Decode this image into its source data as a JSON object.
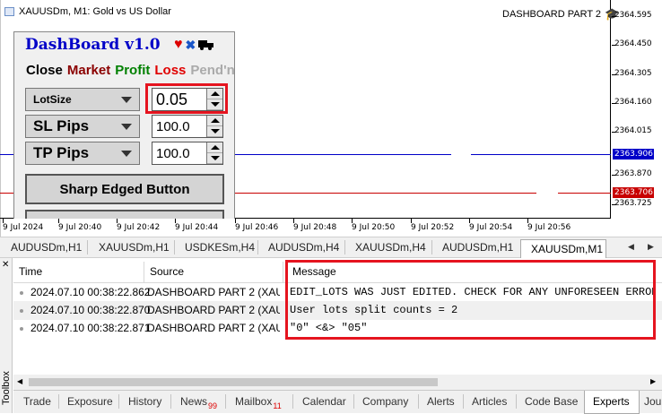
{
  "chart": {
    "title": "XAUUSDm, M1:  Gold vs US Dollar",
    "ea_name": "DASHBOARD PART 2",
    "price_labels": [
      "2364.595",
      "2364.450",
      "2364.305",
      "2364.160",
      "2364.015",
      "2363.870",
      "2363.725"
    ],
    "bid_label": "2363.906",
    "ask_label": "2363.706",
    "bid_color": "#0000c8",
    "ask_color": "#c80000",
    "time_labels": [
      "9 Jul 2024",
      "9 Jul 20:40",
      "9 Jul 20:42",
      "9 Jul 20:44",
      "9 Jul 20:46",
      "9 Jul 20:48",
      "9 Jul 20:50",
      "9 Jul 20:52",
      "9 Jul 20:54",
      "9 Jul 20:56"
    ]
  },
  "dashboard": {
    "title": "DashBoard v1.0",
    "tabs": {
      "close": "Close",
      "market": "Market",
      "profit": "Profit",
      "loss": "Loss",
      "pending": "Pend'n"
    },
    "lotsize": {
      "label": "LotSize",
      "value": "0.05"
    },
    "sl": {
      "label": "SL Pips",
      "value": "100.0"
    },
    "tp": {
      "label": "TP Pips",
      "value": "100.0"
    },
    "button_label": "Sharp Edged Button",
    "highlight_color": "#e5141f"
  },
  "symbol_tabs": [
    "AUDUSDm,H1",
    "XAUUSDm,H1",
    "USDKESm,H4",
    "AUDUSDm,H4",
    "XAUUSDm,H4",
    "AUDUSDm,H1",
    "XAUUSDm,M1"
  ],
  "toolbox": {
    "label": "Toolbox",
    "columns": {
      "time": "Time",
      "source": "Source",
      "message": "Message"
    },
    "rows": [
      {
        "time": "2024.07.10 00:38:22.862",
        "source": "DASHBOARD PART 2 (XAU...",
        "message": "EDIT_LOTS WAS JUST EDITED. CHECK FOR ANY UNFORESEEN ERRORS."
      },
      {
        "time": "2024.07.10 00:38:22.870",
        "source": "DASHBOARD PART 2 (XAU...",
        "message": "User lots split counts = 2"
      },
      {
        "time": "2024.07.10 00:38:22.871",
        "source": "DASHBOARD PART 2 (XAU...",
        "message": "\"0\" <&> \"05\""
      }
    ]
  },
  "bottom_tabs": [
    {
      "label": "Trade"
    },
    {
      "label": "Exposure"
    },
    {
      "label": "History"
    },
    {
      "label": "News",
      "badge": "99"
    },
    {
      "label": "Mailbox",
      "badge": "11"
    },
    {
      "label": "Calendar"
    },
    {
      "label": "Company"
    },
    {
      "label": "Alerts"
    },
    {
      "label": "Articles"
    },
    {
      "label": "Code Base"
    },
    {
      "label": "Experts"
    },
    {
      "label": "Jou"
    }
  ]
}
